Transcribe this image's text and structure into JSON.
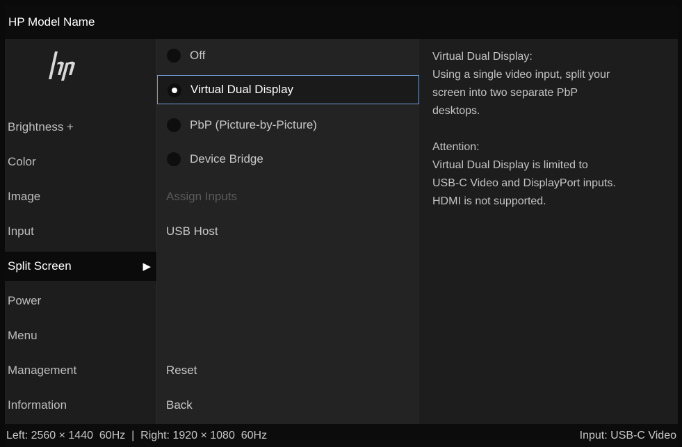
{
  "title_bar": {
    "model_name": "HP Model Name"
  },
  "logo": {
    "icon": "hp-logo-icon"
  },
  "sidebar": {
    "items": [
      {
        "label": "Brightness +"
      },
      {
        "label": "Color"
      },
      {
        "label": "Image"
      },
      {
        "label": "Input"
      },
      {
        "label": "Split Screen",
        "active": true,
        "arrow": "▶"
      },
      {
        "label": "Power"
      },
      {
        "label": "Menu"
      },
      {
        "label": "Management"
      },
      {
        "label": "Information"
      }
    ]
  },
  "options": {
    "radios": [
      {
        "label": "Off",
        "checked": false
      },
      {
        "label": "Virtual Dual Display",
        "checked": true
      },
      {
        "label": "PbP (Picture-by-Picture)",
        "checked": false
      },
      {
        "label": "Device Bridge",
        "checked": false
      }
    ],
    "assign_inputs": "Assign Inputs",
    "usb_host": "USB Host",
    "reset": "Reset",
    "back": "Back"
  },
  "info": {
    "heading": "Virtual Dual Display:",
    "line1": "Using a single video input, split your",
    "line2": "screen into two separate PbP",
    "line3": "desktops.",
    "attention_heading": "Attention:",
    "att_line1": "Virtual Dual Display is limited to",
    "att_line2": "USB-C Video and DisplayPort inputs.",
    "att_line3": "HDMI is not supported."
  },
  "status_bar": {
    "resolution": "Left: 2560 × 1440  60Hz  |  Right: 1920 × 1080  60Hz",
    "input": "Input: USB-C Video"
  },
  "colors": {
    "accent_border": "#6fa0d8",
    "background": "#1d1d1d"
  }
}
